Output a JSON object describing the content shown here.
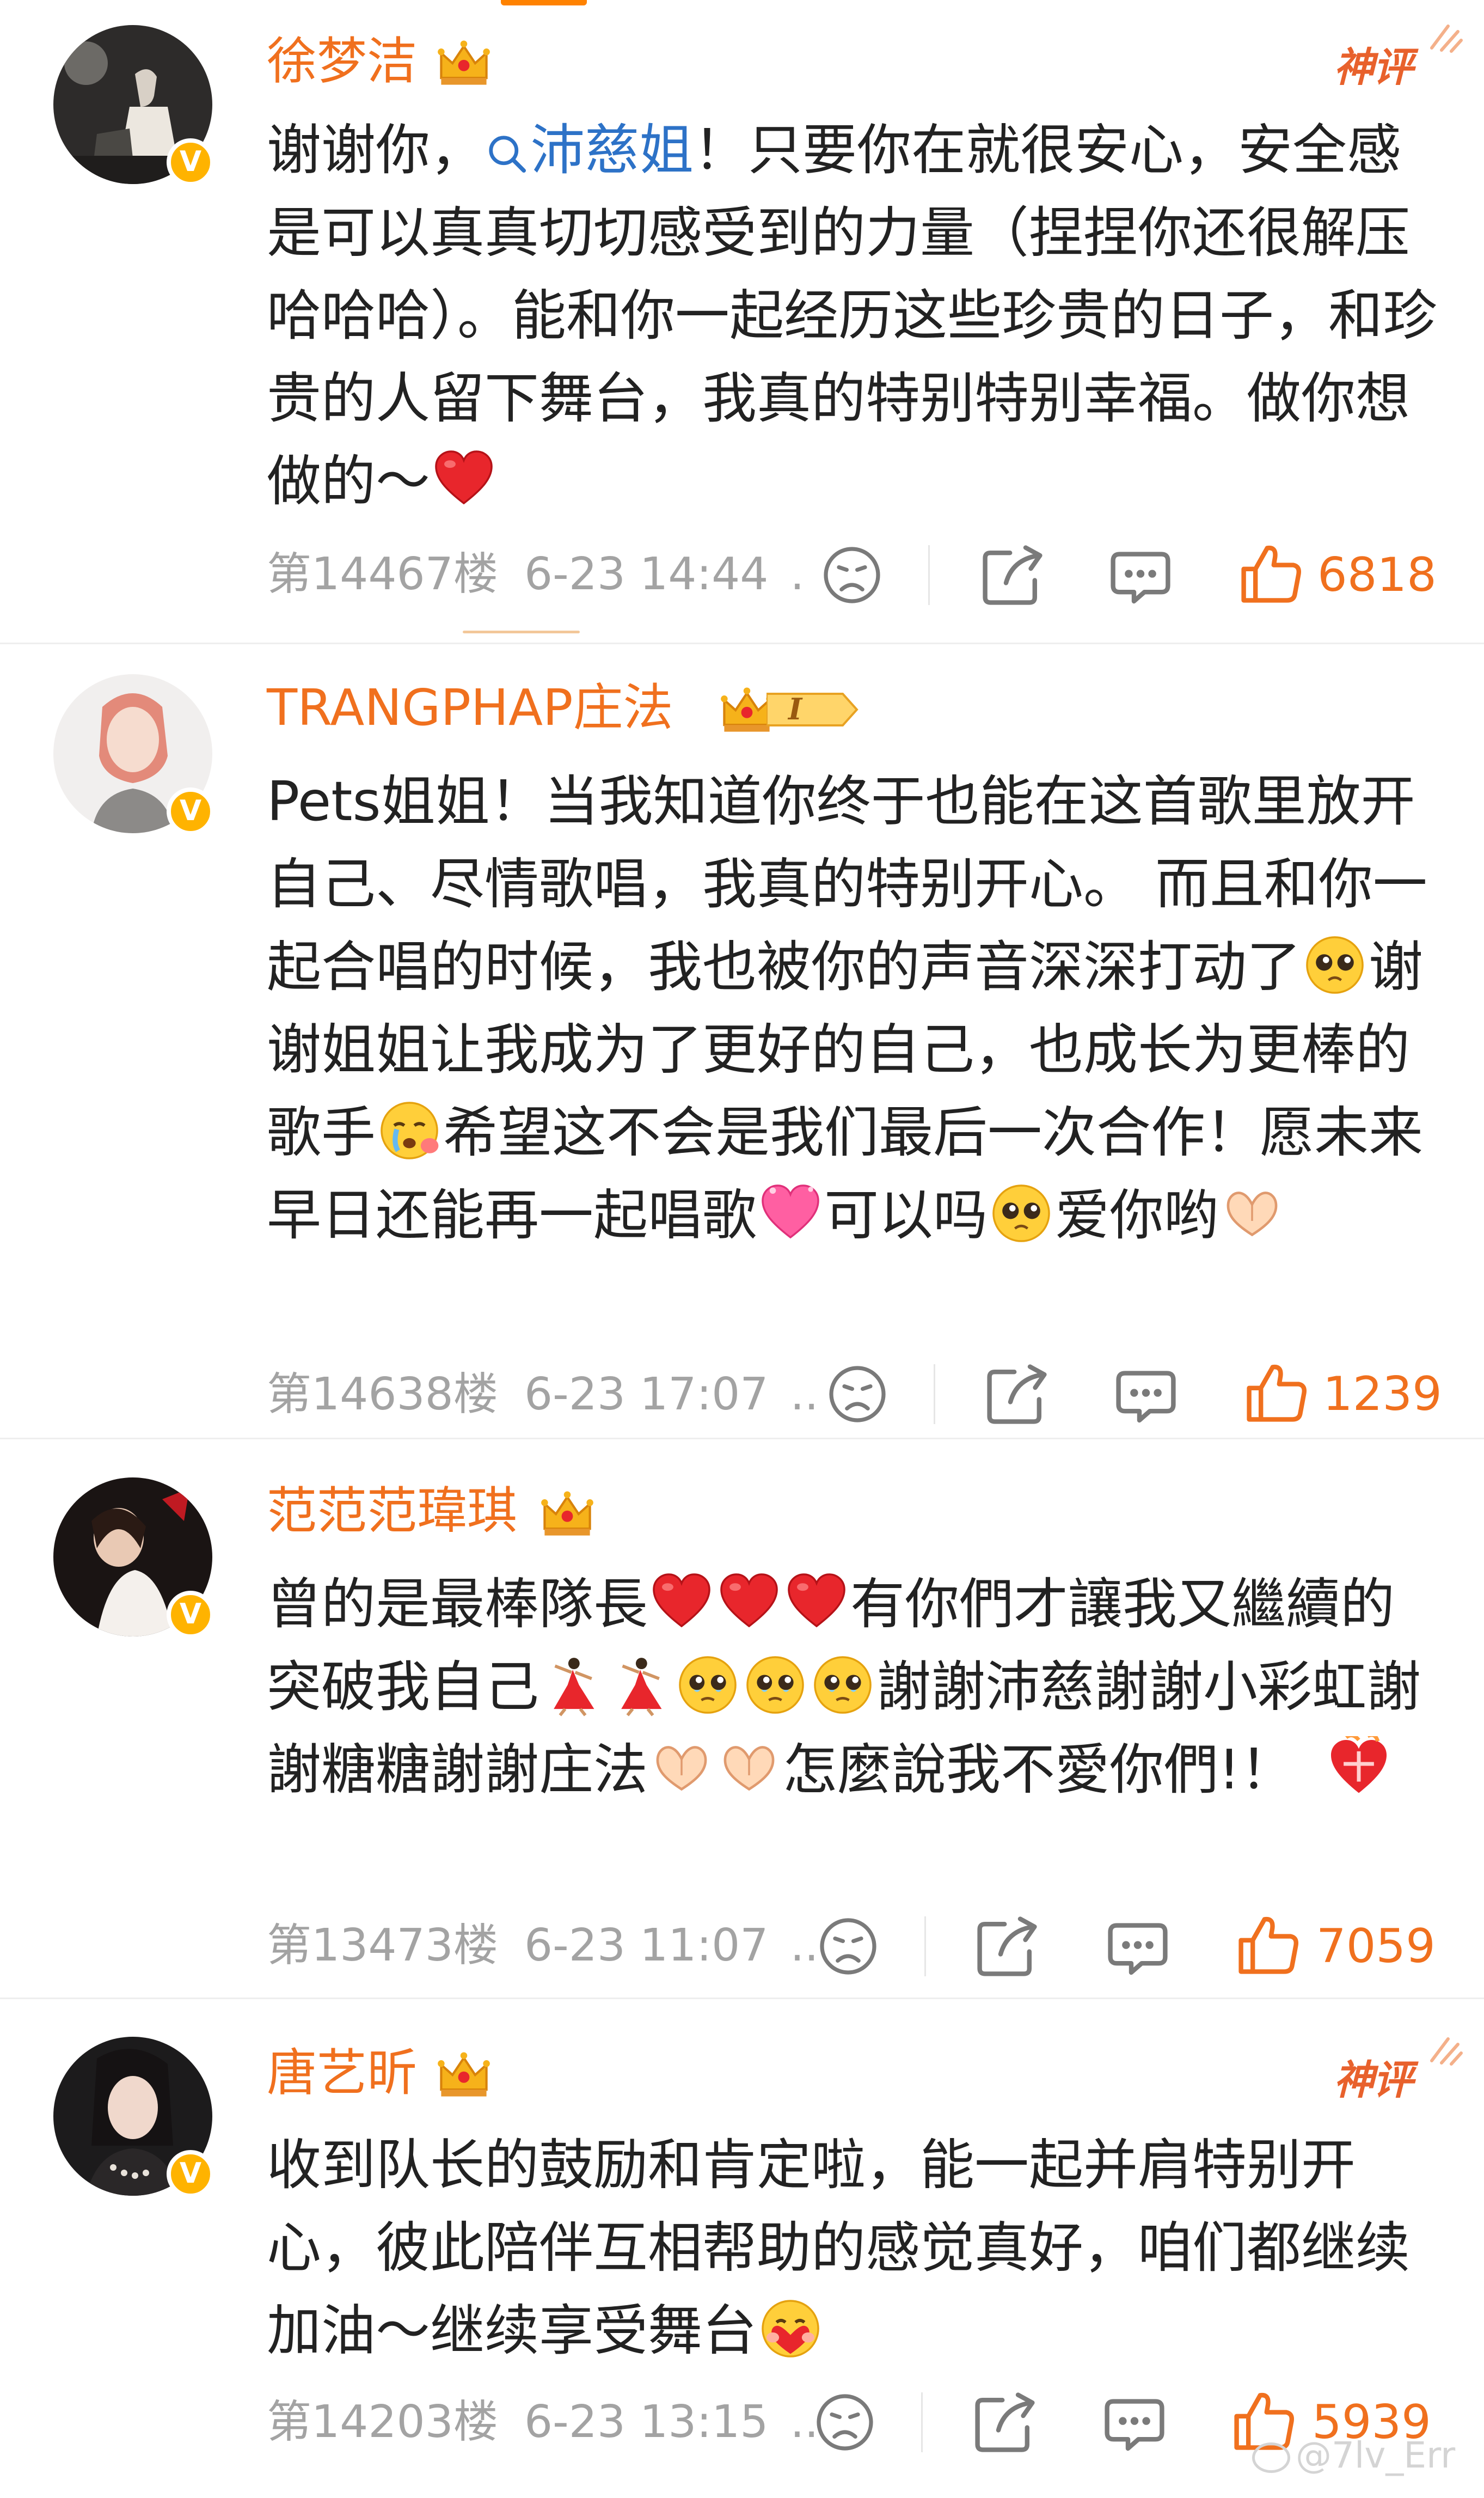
{
  "comments": [
    {
      "username": "徐梦洁",
      "badge": "crown",
      "god_comment": "神评",
      "text_before": "谢谢你，",
      "mention": "沛慈姐",
      "text_after": "！只要你在就很安心，安全感是可以真真切切感受到的力量（捏捏你还很解压哈哈哈）。能和你一起经历这些珍贵的日子，和珍贵的人留下舞台，我真的特别特别幸福。做你想做的～",
      "emoji_end": "red-heart",
      "floor": "第14467楼",
      "time": "6-23 14:44",
      "ellipsis": ".",
      "likes": "6818"
    },
    {
      "username": "TRANGPHAP庄法",
      "badge": "crown-level-1",
      "level": "I",
      "segments": [
        "Pets姐姐！当我知道你终于也能在这首歌里放开自己、尽情歌唱，我真的特别开心。 而且和你一起合唱的时候，我也被你的声音深深打动了",
        "谢谢姐姐让我成为了更好的自己，也成长为更棒的歌手",
        "希望这不会是我们最后一次合作！愿未来早日还能再一起唱歌",
        "可以吗",
        "爱你哟"
      ],
      "floor": "第14638楼",
      "time": "6-23 17:07",
      "ellipsis": "..",
      "likes": "1239"
    },
    {
      "username": "范范范瑋琪",
      "badge": "crown",
      "segments": [
        "曾的是最棒隊長",
        "有你們才讓我又繼續的突破我自己",
        "謝謝沛慈謝謝小彩虹謝謝糖糖謝謝庄法",
        "怎麼說我不愛你們!！"
      ],
      "floor": "第13473楼",
      "time": "6-23 11:07",
      "ellipsis": "..",
      "likes": "7059"
    },
    {
      "username": "唐艺昕",
      "badge": "crown",
      "god_comment": "神评",
      "segments": [
        "收到队长的鼓励和肯定啦，能一起并肩特别开心，彼此陪伴互相帮助的感觉真好，咱们都继续加油～继续享受舞台"
      ],
      "floor": "第14203楼",
      "time": "6-23 13:15",
      "ellipsis": "..",
      "likes": "5939"
    }
  ],
  "watermark": "@7lv_Err",
  "colors": {
    "username": "#f0701e",
    "mention": "#2d72c7",
    "body": "#222222",
    "meta": "#a3a3a3",
    "likes": "#f0701e",
    "accent": "#ff8200"
  },
  "icons": [
    "v-verified-icon",
    "crown-icon",
    "search-icon",
    "dislike-face-icon",
    "share-icon",
    "comment-icon",
    "thumbs-up-icon",
    "red-heart-emoji",
    "pleading-face-emoji",
    "crying-face-emoji",
    "heart-emoji",
    "heart-hands-emoji",
    "dancer-emoji",
    "mending-heart-emoji",
    "hugging-face-emoji"
  ]
}
